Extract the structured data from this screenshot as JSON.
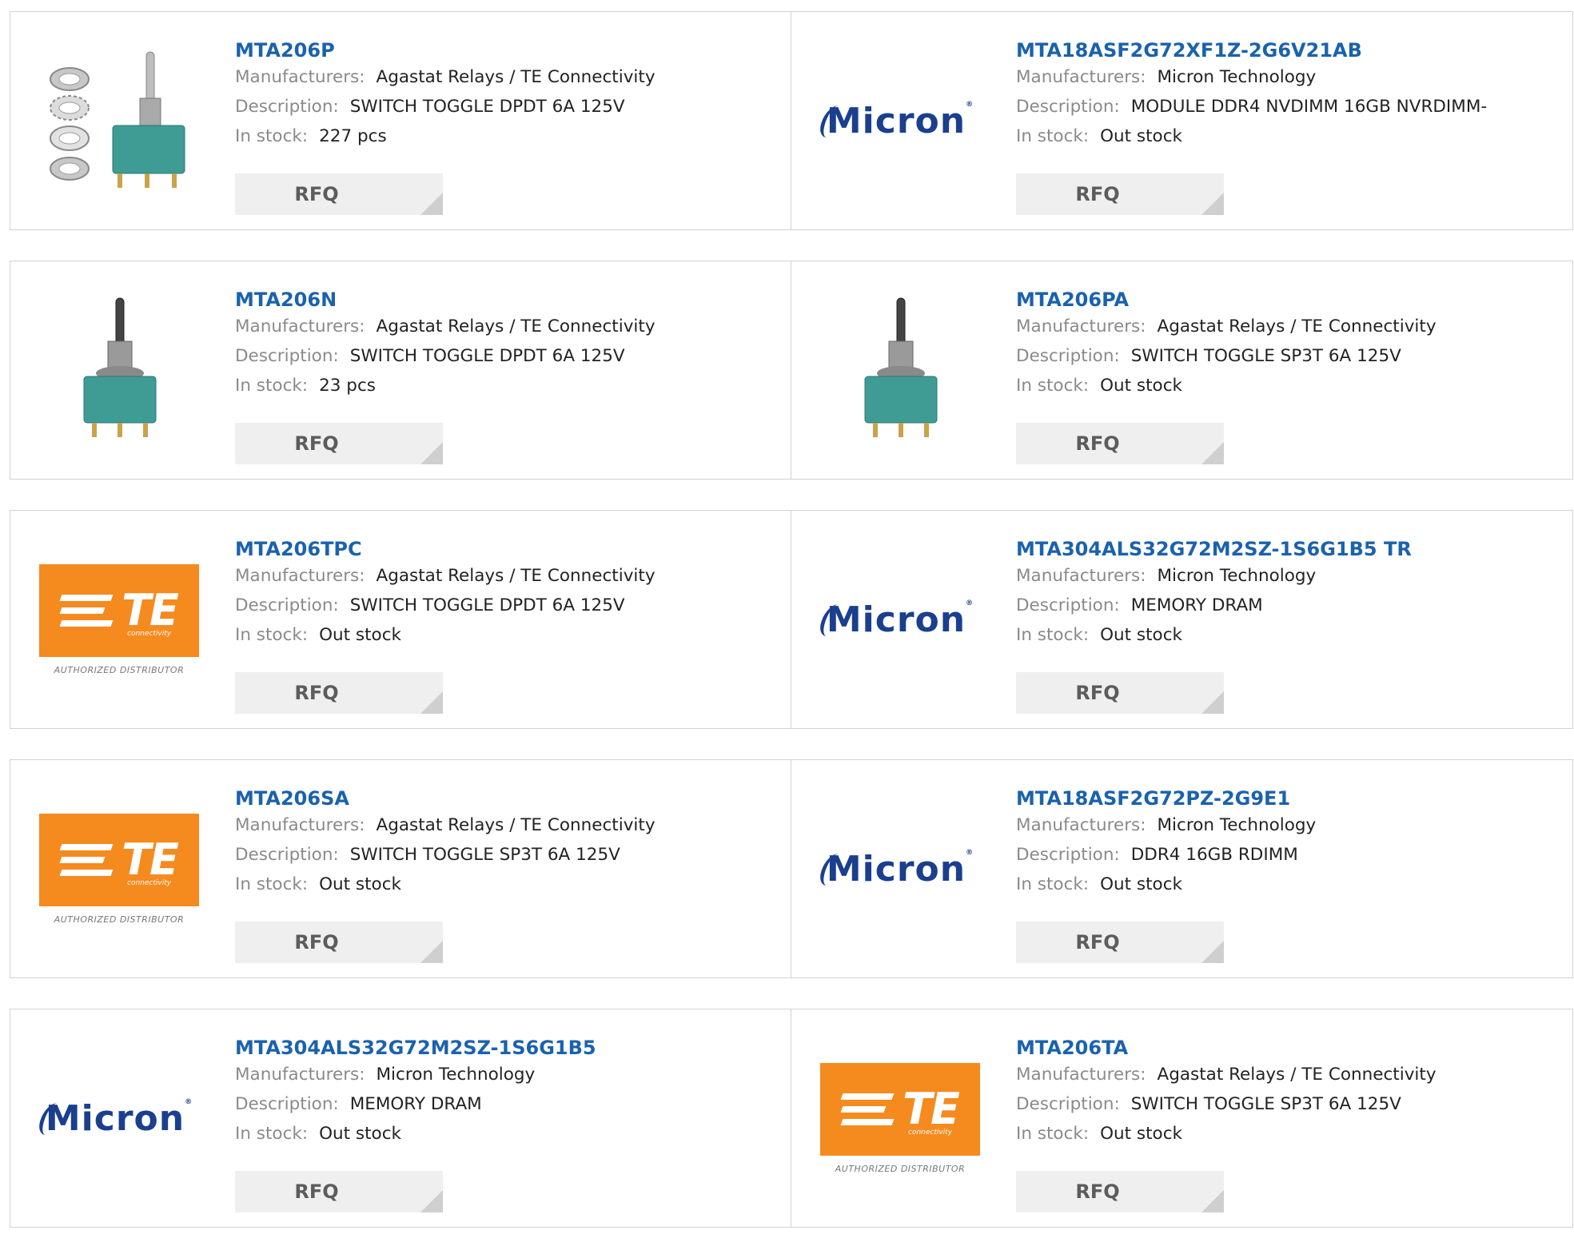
{
  "labels": {
    "manufacturers": "Manufacturers:",
    "description": "Description:",
    "in_stock": "In stock:",
    "rfq": "RFQ"
  },
  "logos": {
    "micron": "Micron",
    "te_mark": "TE",
    "te_sub": "connectivity",
    "te_authorized": "AUTHORIZED DISTRIBUTOR"
  },
  "colors": {
    "link": "#1a62ad",
    "te_orange": "#f58a1f",
    "micron_blue": "#1b3f8f"
  },
  "products": [
    {
      "part": "MTA206P",
      "manufacturer": "Agastat Relays / TE Connectivity",
      "description": "SWITCH TOGGLE DPDT 6A 125V",
      "stock": "227 pcs",
      "image": "toggle-switch-with-nuts"
    },
    {
      "part": "MTA18ASF2G72XF1Z-2G6V21AB",
      "manufacturer": "Micron Technology",
      "description": "MODULE DDR4 NVDIMM 16GB NVRDIMM-",
      "stock": "Out stock",
      "image": "micron-logo"
    },
    {
      "part": "MTA206N",
      "manufacturer": "Agastat Relays / TE Connectivity",
      "description": "SWITCH TOGGLE DPDT 6A 125V",
      "stock": "23 pcs",
      "image": "toggle-switch"
    },
    {
      "part": "MTA206PA",
      "manufacturer": "Agastat Relays / TE Connectivity",
      "description": "SWITCH TOGGLE SP3T 6A 125V",
      "stock": "Out stock",
      "image": "toggle-switch"
    },
    {
      "part": "MTA206TPC",
      "manufacturer": "Agastat Relays / TE Connectivity",
      "description": "SWITCH TOGGLE DPDT 6A 125V",
      "stock": "Out stock",
      "image": "te-logo"
    },
    {
      "part": "MTA304ALS32G72M2SZ-1S6G1B5 TR",
      "manufacturer": "Micron Technology",
      "description": "MEMORY DRAM",
      "stock": "Out stock",
      "image": "micron-logo"
    },
    {
      "part": "MTA206SA",
      "manufacturer": "Agastat Relays / TE Connectivity",
      "description": "SWITCH TOGGLE SP3T 6A 125V",
      "stock": "Out stock",
      "image": "te-logo"
    },
    {
      "part": "MTA18ASF2G72PZ-2G9E1",
      "manufacturer": "Micron Technology",
      "description": "DDR4 16GB RDIMM",
      "stock": "Out stock",
      "image": "micron-logo"
    },
    {
      "part": "MTA304ALS32G72M2SZ-1S6G1B5",
      "manufacturer": "Micron Technology",
      "description": "MEMORY DRAM",
      "stock": "Out stock",
      "image": "micron-logo"
    },
    {
      "part": "MTA206TA",
      "manufacturer": "Agastat Relays / TE Connectivity",
      "description": "SWITCH TOGGLE SP3T 6A 125V",
      "stock": "Out stock",
      "image": "te-logo"
    }
  ]
}
